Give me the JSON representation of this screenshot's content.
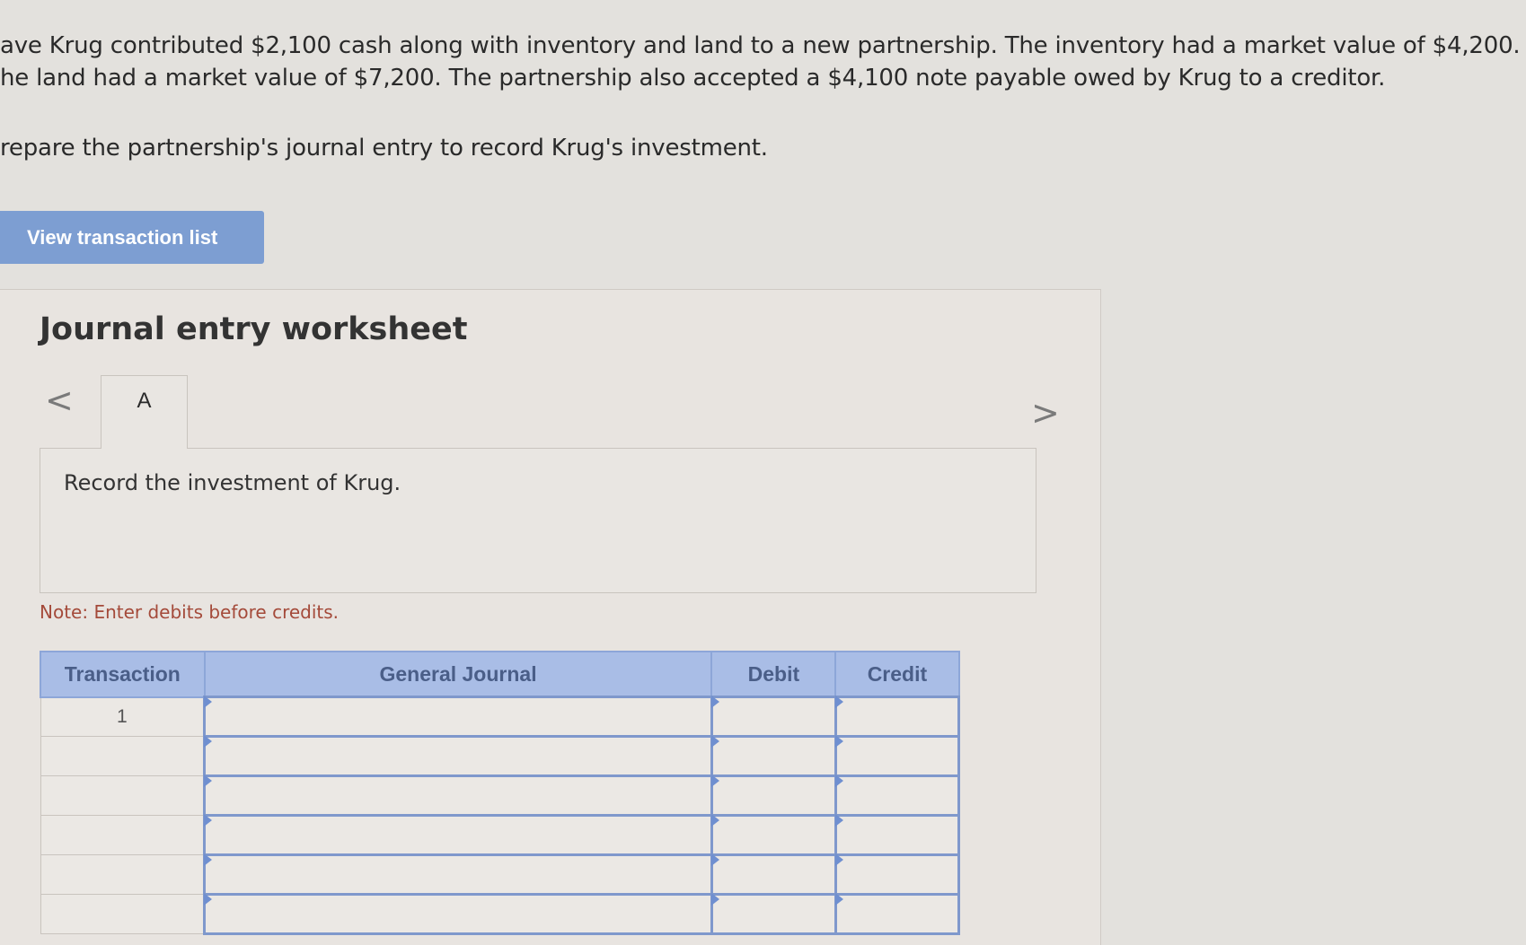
{
  "problem": {
    "line1": "ave Krug contributed $2,100 cash along with inventory and land to a new partnership. The inventory had a market value of $4,200.",
    "line2": "he land had a market value of $7,200. The partnership also accepted a $4,100 note payable owed by Krug to a creditor.",
    "line3": "repare the partnership's journal entry to record Krug's investment."
  },
  "buttons": {
    "view_transaction_list": "View transaction list"
  },
  "worksheet": {
    "title": "Journal entry worksheet",
    "prev_icon": "chevron-left-icon",
    "next_icon": "chevron-right-icon",
    "prev_glyph": "<",
    "next_glyph": ">",
    "tab_label": "A",
    "instruction": "Record the investment of Krug.",
    "note": "Note: Enter debits before credits."
  },
  "table": {
    "headers": [
      "Transaction",
      "General Journal",
      "Debit",
      "Credit"
    ],
    "rows": [
      {
        "transaction": "1",
        "account": "",
        "debit": "",
        "credit": ""
      },
      {
        "transaction": "",
        "account": "",
        "debit": "",
        "credit": ""
      },
      {
        "transaction": "",
        "account": "",
        "debit": "",
        "credit": ""
      },
      {
        "transaction": "",
        "account": "",
        "debit": "",
        "credit": ""
      },
      {
        "transaction": "",
        "account": "",
        "debit": "",
        "credit": ""
      },
      {
        "transaction": "",
        "account": "",
        "debit": "",
        "credit": ""
      }
    ]
  },
  "colors": {
    "button": "#7d9ed2",
    "header": "#a9bde6",
    "note": "#a44a3a"
  }
}
